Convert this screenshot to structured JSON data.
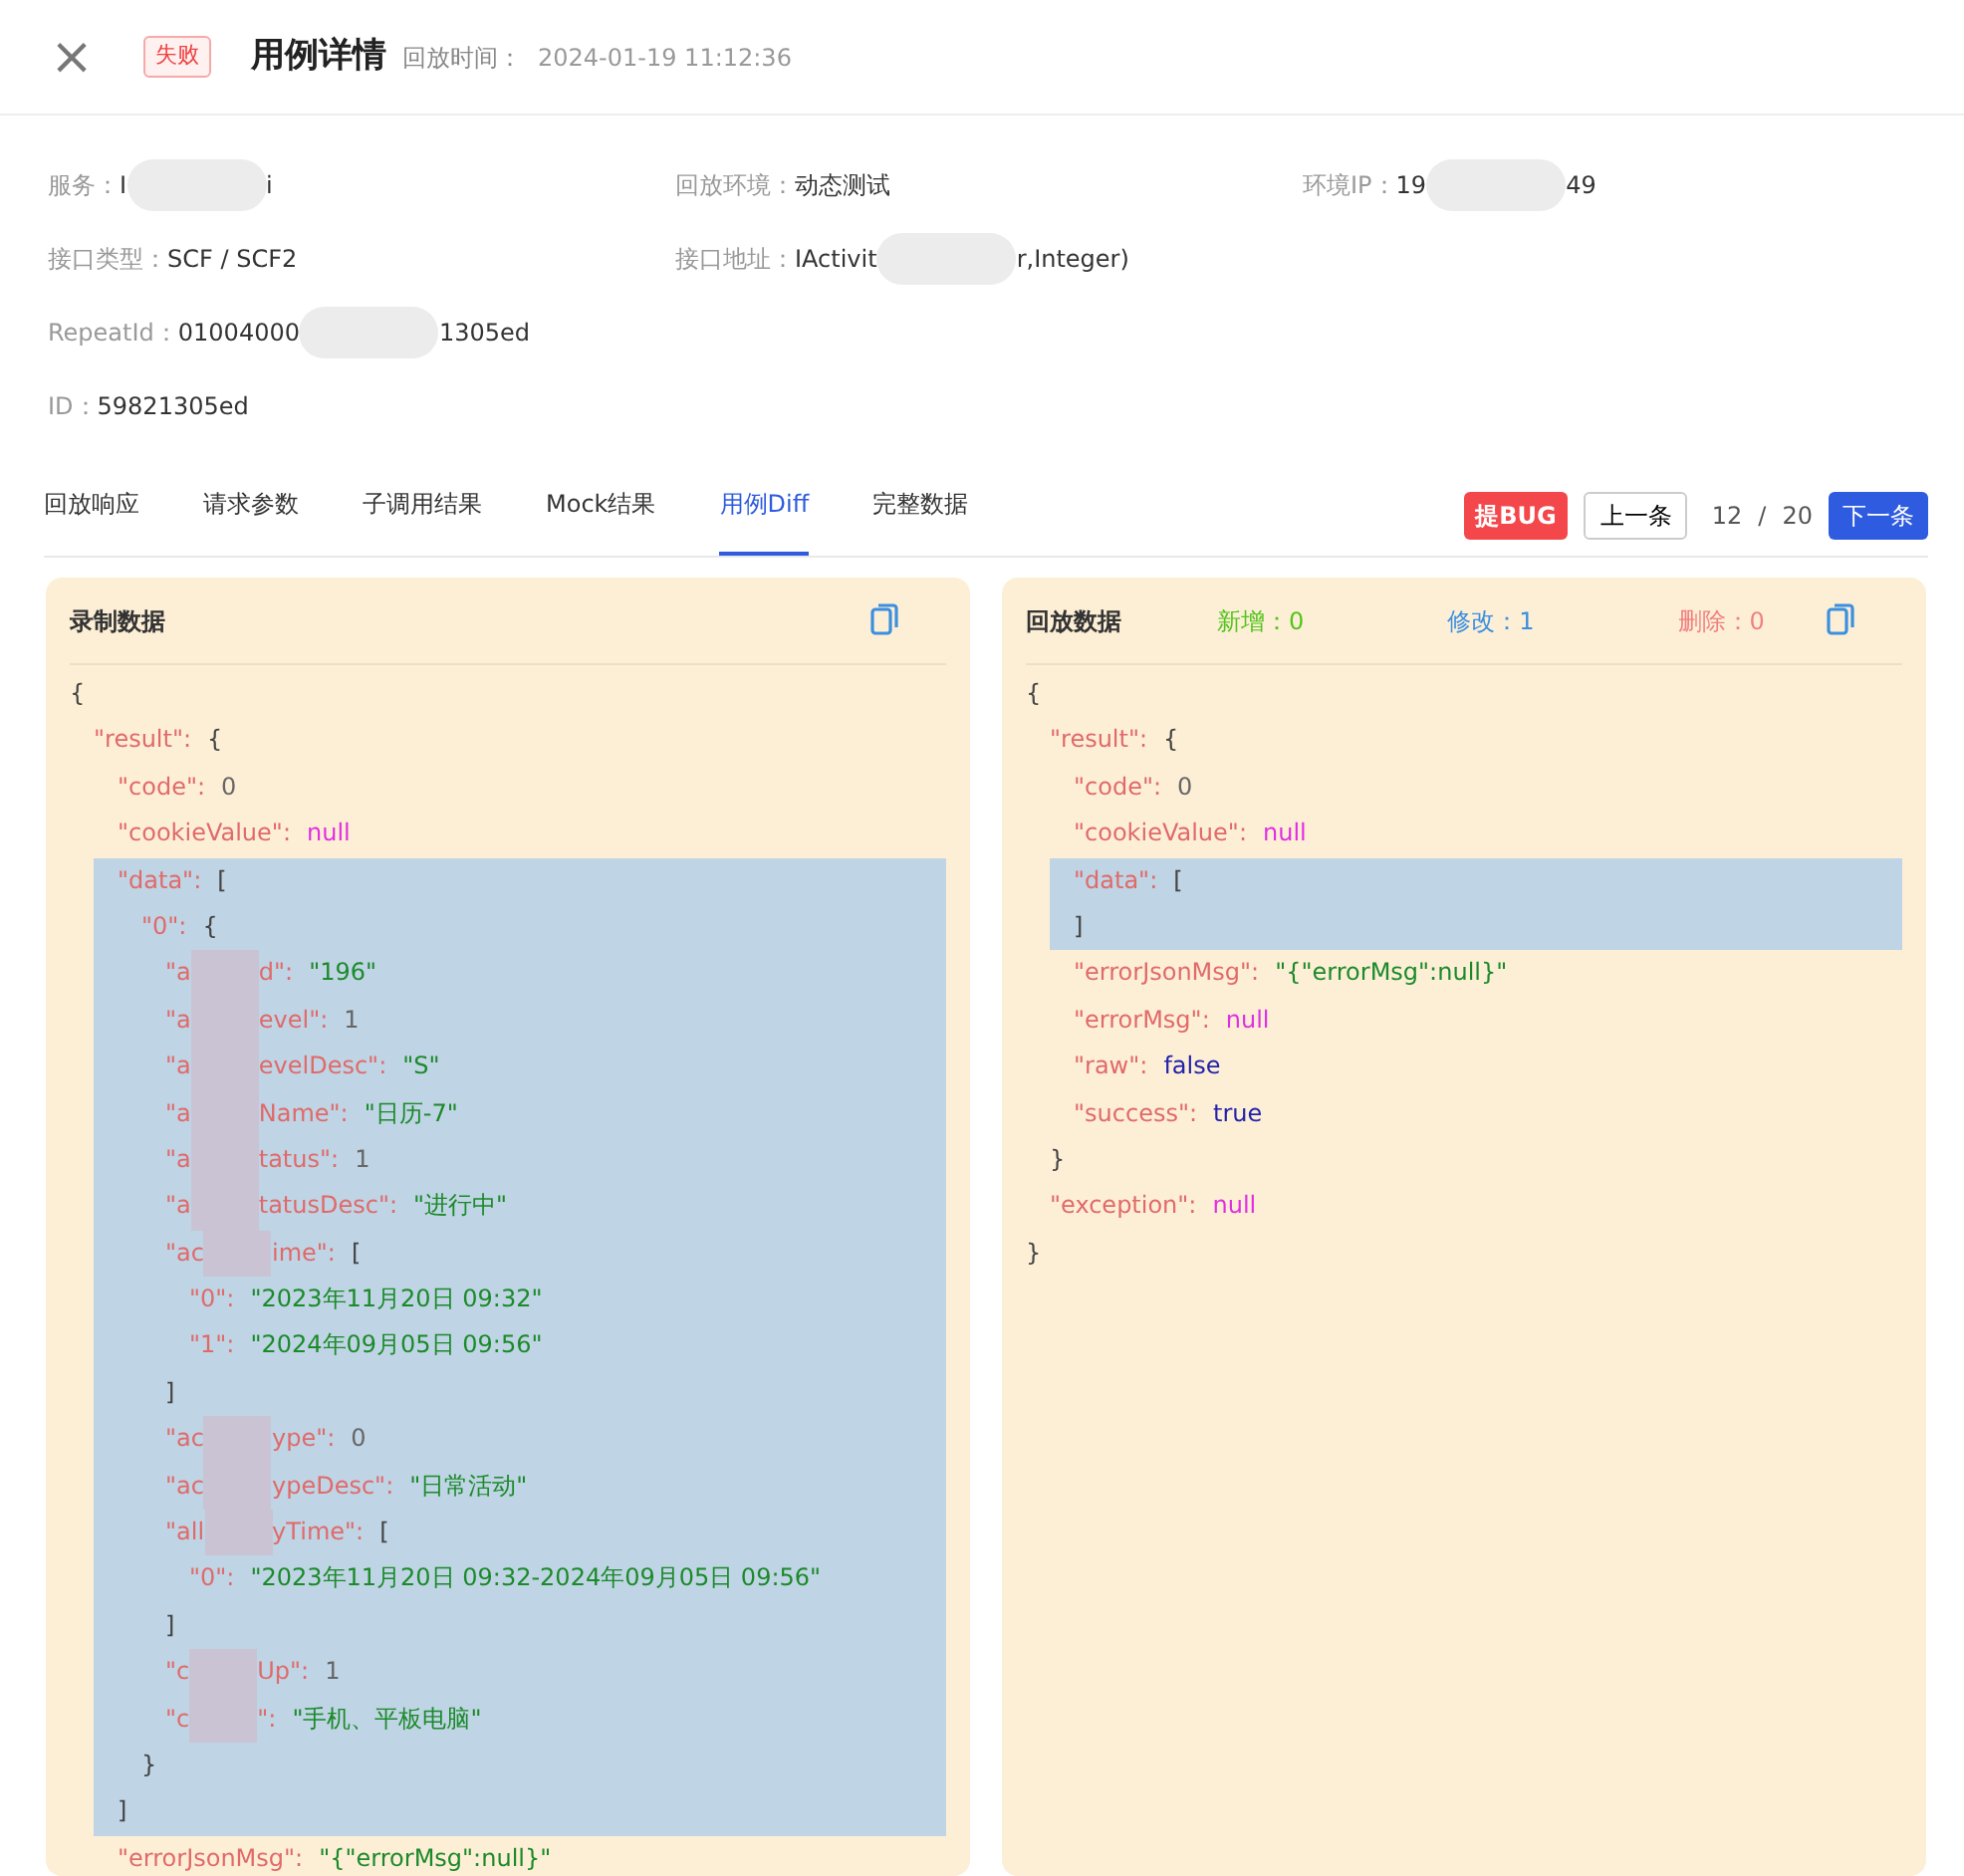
{
  "header": {
    "close": "×",
    "status_badge": "失败",
    "title": "用例详情",
    "time_label": "回放时间：",
    "time_value": "2024-01-19 11:12:36"
  },
  "info_rows": [
    [
      {
        "label": "服务：",
        "value_parts": [
          "I",
          "i"
        ]
      },
      {
        "label": "回放环境：",
        "value_parts": [
          "动态测试"
        ]
      },
      {
        "label": "环境IP：",
        "value_parts": [
          "19",
          "49"
        ]
      }
    ],
    [
      {
        "label": "接口类型：",
        "value_parts": [
          "SCF / SCF2"
        ]
      },
      {
        "label": "接口地址：",
        "value_parts": [
          "IActivit",
          "r,Integer)"
        ]
      }
    ],
    [
      {
        "label": "RepeatId：",
        "value_parts": [
          "01004000",
          "1305ed"
        ]
      }
    ],
    [
      {
        "label": "ID：",
        "value_parts": [
          "59821305ed"
        ]
      }
    ]
  ],
  "tabs": [
    {
      "label": "回放响应",
      "selected": false
    },
    {
      "label": "请求参数",
      "selected": false
    },
    {
      "label": "子调用结果",
      "selected": false
    },
    {
      "label": "Mock结果",
      "selected": false
    },
    {
      "label": "用例Diff",
      "selected": true
    },
    {
      "label": "完整数据",
      "selected": false
    }
  ],
  "actions": {
    "bug_button": "提BUG",
    "prev_button": "上一条",
    "current": "12",
    "separator": "/",
    "total": "20",
    "next_button": "下一条"
  },
  "panels": [
    {
      "title": "录制数据",
      "tree": [
        {
          "value": "{",
          "kind": "bracket",
          "highlighted": false,
          "children": [
            {
              "key_parts": [
                "\"result\":"
              ],
              "value": "{",
              "kind": "bracket",
              "highlighted": false,
              "children": [
                {
                  "key_parts": [
                    "\"code\":"
                  ],
                  "value": "0",
                  "kind": "number",
                  "highlighted": false
                },
                {
                  "key_parts": [
                    "\"cookieValue\":"
                  ],
                  "value": "null",
                  "kind": "null",
                  "highlighted": false
                },
                {
                  "key_parts": [
                    "\"data\":"
                  ],
                  "value": "[",
                  "kind": "bracket",
                  "highlighted": true,
                  "closing": "]",
                  "children": [
                    {
                      "key_parts": [
                        "\"0\":"
                      ],
                      "value": "{",
                      "kind": "bracket",
                      "highlighted": false,
                      "closing": "}",
                      "children": [
                        {
                          "key_parts": [
                            "\"a",
                            "d\":"
                          ],
                          "value": "\"196\"",
                          "kind": "string",
                          "highlighted": false
                        },
                        {
                          "key_parts": [
                            "\"a",
                            "evel\":"
                          ],
                          "value": "1",
                          "kind": "number",
                          "highlighted": false
                        },
                        {
                          "key_parts": [
                            "\"a",
                            "evelDesc\":"
                          ],
                          "value": "\"S\"",
                          "kind": "string",
                          "highlighted": false
                        },
                        {
                          "key_parts": [
                            "\"a",
                            "Name\":"
                          ],
                          "value": "\"日历-7\"",
                          "kind": "string",
                          "highlighted": false
                        },
                        {
                          "key_parts": [
                            "\"a",
                            "tatus\":"
                          ],
                          "value": "1",
                          "kind": "number",
                          "highlighted": false
                        },
                        {
                          "key_parts": [
                            "\"a",
                            "tatusDesc\":"
                          ],
                          "value": "\"进行中\"",
                          "kind": "string",
                          "highlighted": false
                        },
                        {
                          "key_parts": [
                            "\"ac",
                            "ime\":"
                          ],
                          "value": "[",
                          "kind": "bracket",
                          "highlighted": false,
                          "closing": "]",
                          "children": [
                            {
                              "key_parts": [
                                "\"0\":"
                              ],
                              "value": "\"2023年11月20日 09:32\"",
                              "kind": "string",
                              "highlighted": false
                            },
                            {
                              "key_parts": [
                                "\"1\":"
                              ],
                              "value": "\"2024年09月05日 09:56\"",
                              "kind": "string",
                              "highlighted": false
                            }
                          ]
                        },
                        {
                          "key_parts": [
                            "\"ac",
                            "ype\":"
                          ],
                          "value": "0",
                          "kind": "number",
                          "highlighted": false
                        },
                        {
                          "key_parts": [
                            "\"ac",
                            "ypeDesc\":"
                          ],
                          "value": "\"日常活动\"",
                          "kind": "string",
                          "highlighted": false
                        },
                        {
                          "key_parts": [
                            "\"all",
                            "yTime\":"
                          ],
                          "value": "[",
                          "kind": "bracket",
                          "highlighted": false,
                          "closing": "]",
                          "children": [
                            {
                              "key_parts": [
                                "\"0\":"
                              ],
                              "value": "\"2023年11月20日 09:32-2024年09月05日 09:56\"",
                              "kind": "string",
                              "highlighted": false
                            }
                          ]
                        },
                        {
                          "key_parts": [
                            "\"c",
                            "Up\":"
                          ],
                          "value": "1",
                          "kind": "number",
                          "highlighted": false
                        },
                        {
                          "key_parts": [
                            "\"c",
                            "\":"
                          ],
                          "value": "\"手机、平板电脑\"",
                          "kind": "string",
                          "highlighted": false
                        }
                      ]
                    }
                  ]
                },
                {
                  "key_parts": [
                    "\"errorJsonMsg\":"
                  ],
                  "value": "\"{\"errorMsg\":null}\"",
                  "kind": "string",
                  "highlighted": false
                }
              ]
            }
          ]
        }
      ]
    },
    {
      "title": "回放数据",
      "stats": [
        {
          "label": "新增：0",
          "color": "#52c41a"
        },
        {
          "label": "修改：1",
          "color": "#3b8fe0"
        },
        {
          "label": "删除：0",
          "color": "#f08080"
        }
      ],
      "tree": [
        {
          "value": "{",
          "kind": "bracket",
          "highlighted": false,
          "closing": "}",
          "children": [
            {
              "key_parts": [
                "\"result\":"
              ],
              "value": "{",
              "kind": "bracket",
              "highlighted": false,
              "closing": "}",
              "children": [
                {
                  "key_parts": [
                    "\"code\":"
                  ],
                  "value": "0",
                  "kind": "number",
                  "highlighted": false
                },
                {
                  "key_parts": [
                    "\"cookieValue\":"
                  ],
                  "value": "null",
                  "kind": "null",
                  "highlighted": false
                },
                {
                  "key_parts": [
                    "\"data\":"
                  ],
                  "value": "[",
                  "kind": "bracket",
                  "highlighted": true,
                  "closing": "]"
                },
                {
                  "key_parts": [
                    "\"errorJsonMsg\":"
                  ],
                  "value": "\"{\"errorMsg\":null}\"",
                  "kind": "string",
                  "highlighted": false
                },
                {
                  "key_parts": [
                    "\"errorMsg\":"
                  ],
                  "value": "null",
                  "kind": "null",
                  "highlighted": false
                },
                {
                  "key_parts": [
                    "\"raw\":"
                  ],
                  "value": "false",
                  "kind": "boolean",
                  "highlighted": false
                },
                {
                  "key_parts": [
                    "\"success\":"
                  ],
                  "value": "true",
                  "kind": "boolean",
                  "highlighted": false
                }
              ]
            },
            {
              "key_parts": [
                "\"exception\":"
              ],
              "value": "null",
              "kind": "null",
              "highlighted": false
            }
          ]
        }
      ]
    }
  ]
}
